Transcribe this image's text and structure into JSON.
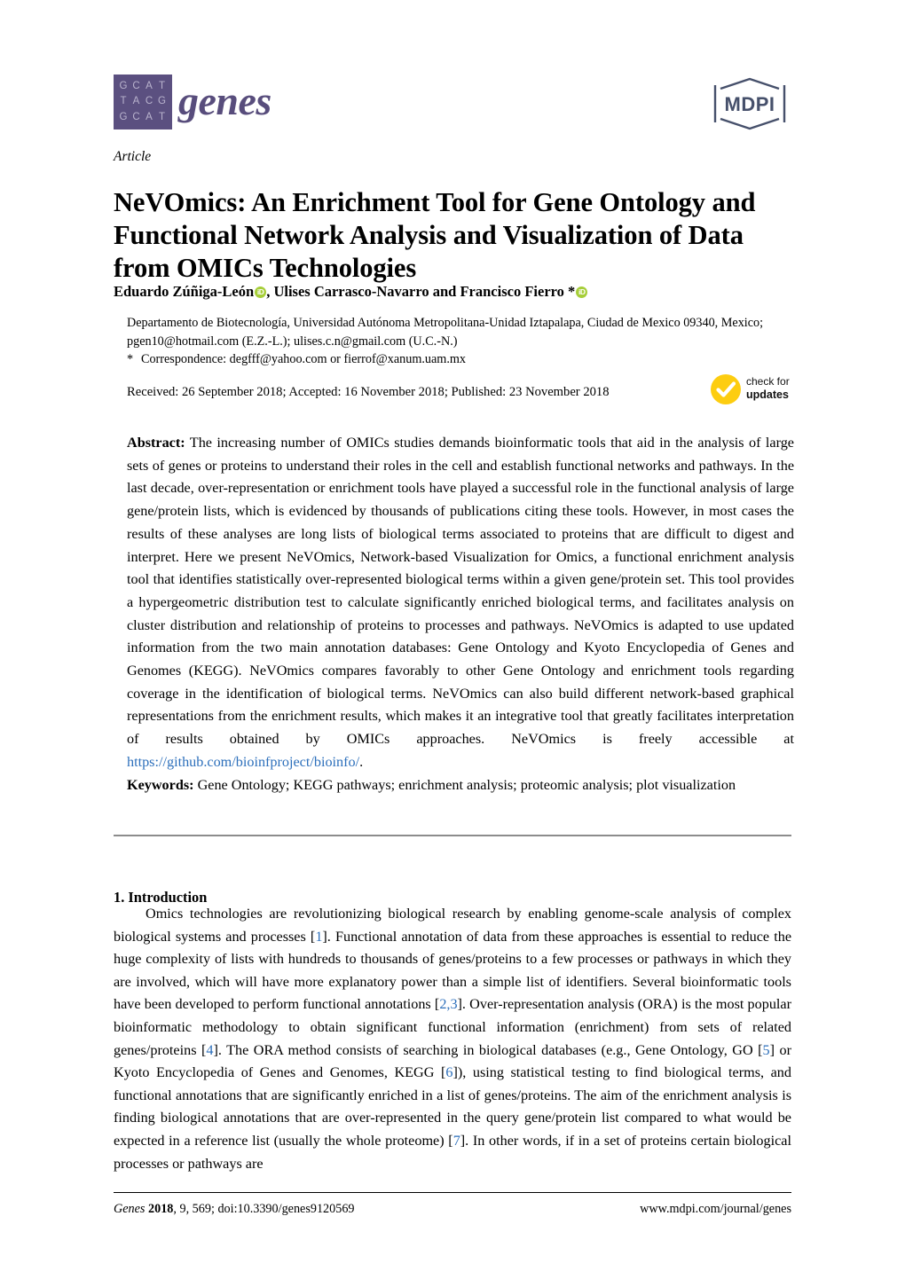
{
  "journal": {
    "logo_letters": [
      "G",
      "C",
      "A",
      "T",
      "T",
      "A",
      "C",
      "G",
      "G",
      "C",
      "A",
      "T"
    ],
    "wordmark": "genes",
    "publisher_logo_text": "MDPI",
    "brand_purple": "#5b5080",
    "orcid_green": "#a6ce39",
    "link_blue": "#2c6fbb",
    "badge_yellow": "#fdcd10"
  },
  "article": {
    "type_label": "Article",
    "title": "NeVOmics: An Enrichment Tool for Gene Ontology and Functional Network Analysis and Visualization of Data from OMICs Technologies",
    "authors_line_1": "Eduardo Zúñiga-León",
    "authors_line_2": ", Ulises Carrasco-Navarro and Francisco Fierro *",
    "orcid_label": "iD",
    "affiliation": "Departamento de Biotecnología, Universidad Autónoma Metropolitana-Unidad Iztapalapa, Ciudad de Mexico 09340, Mexico; pgen10@hotmail.com (E.Z.-L.); ulises.c.n@gmail.com (U.C.-N.)",
    "correspondence_marker": "*",
    "correspondence": "Correspondence: degfff@yahoo.com or fierrof@xanum.uam.mx",
    "dates": "Received: 26 September 2018; Accepted: 16 November 2018; Published: 23 November 2018"
  },
  "update_badge": {
    "line1": "check for",
    "line2": "updates"
  },
  "abstract": {
    "label": "Abstract:",
    "text_before_link": " The increasing number of OMICs studies demands bioinformatic tools that aid in the analysis of large sets of genes or proteins to understand their roles in the cell and establish functional networks and pathways. In the last decade, over-representation or enrichment tools have played a successful role in the functional analysis of large gene/protein lists, which is evidenced by thousands of publications citing these tools. However, in most cases the results of these analyses are long lists of biological terms associated to proteins that are difficult to digest and interpret. Here we present NeVOmics, Network-based Visualization for Omics, a functional enrichment analysis tool that identifies statistically over-represented biological terms within a given gene/protein set. This tool provides a hypergeometric distribution test to calculate significantly enriched biological terms, and facilitates analysis on cluster distribution and relationship of proteins to processes and pathways. NeVOmics is adapted to use updated information from the two main annotation databases: Gene Ontology and Kyoto Encyclopedia of Genes and Genomes (KEGG). NeVOmics compares favorably to other Gene Ontology and enrichment tools regarding coverage in the identification of biological terms. NeVOmics can also build different network-based graphical representations from the enrichment results, which makes it an integrative tool that greatly facilitates interpretation of results obtained by OMICs approaches. NeVOmics is freely accessible at ",
    "link": "https://github.com/bioinfproject/bioinfo/",
    "text_after_link": "."
  },
  "keywords": {
    "label": "Keywords:",
    "text": " Gene Ontology; KEGG pathways; enrichment analysis; proteomic analysis; plot visualization"
  },
  "sections": [
    {
      "heading": "1. Introduction",
      "paragraph_parts": [
        {
          "t": "Omics technologies are revolutionizing biological research by enabling genome-scale analysis of complex biological systems and processes ["
        },
        {
          "c": "1"
        },
        {
          "t": "]. Functional annotation of data from these approaches is essential to reduce the huge complexity of lists with hundreds to thousands of genes/proteins to a few processes or pathways in which they are involved, which will have more explanatory power than a simple list of identifiers. Several bioinformatic tools have been developed to perform functional annotations ["
        },
        {
          "c": "2,3"
        },
        {
          "t": "]. Over-representation analysis (ORA) is the most popular bioinformatic methodology to obtain significant functional information (enrichment) from sets of related genes/proteins ["
        },
        {
          "c": "4"
        },
        {
          "t": "]. The ORA method consists of searching in biological databases (e.g., Gene Ontology, GO ["
        },
        {
          "c": "5"
        },
        {
          "t": "] or Kyoto Encyclopedia of Genes and Genomes, KEGG ["
        },
        {
          "c": "6"
        },
        {
          "t": "]), using statistical testing to find biological terms, and functional annotations that are significantly enriched in a list of genes/proteins. The aim of the enrichment analysis is finding biological annotations that are over-represented in the query gene/protein list compared to what would be expected in a reference list (usually the whole proteome) ["
        },
        {
          "c": "7"
        },
        {
          "t": "]. In other words, if in a set of proteins certain biological processes or pathways are"
        }
      ]
    }
  ],
  "footer": {
    "journal_italic": "Genes",
    "year": "2018",
    "citation_rest": ", 9, 569; doi:10.3390/genes9120569",
    "website": "www.mdpi.com/journal/genes"
  }
}
